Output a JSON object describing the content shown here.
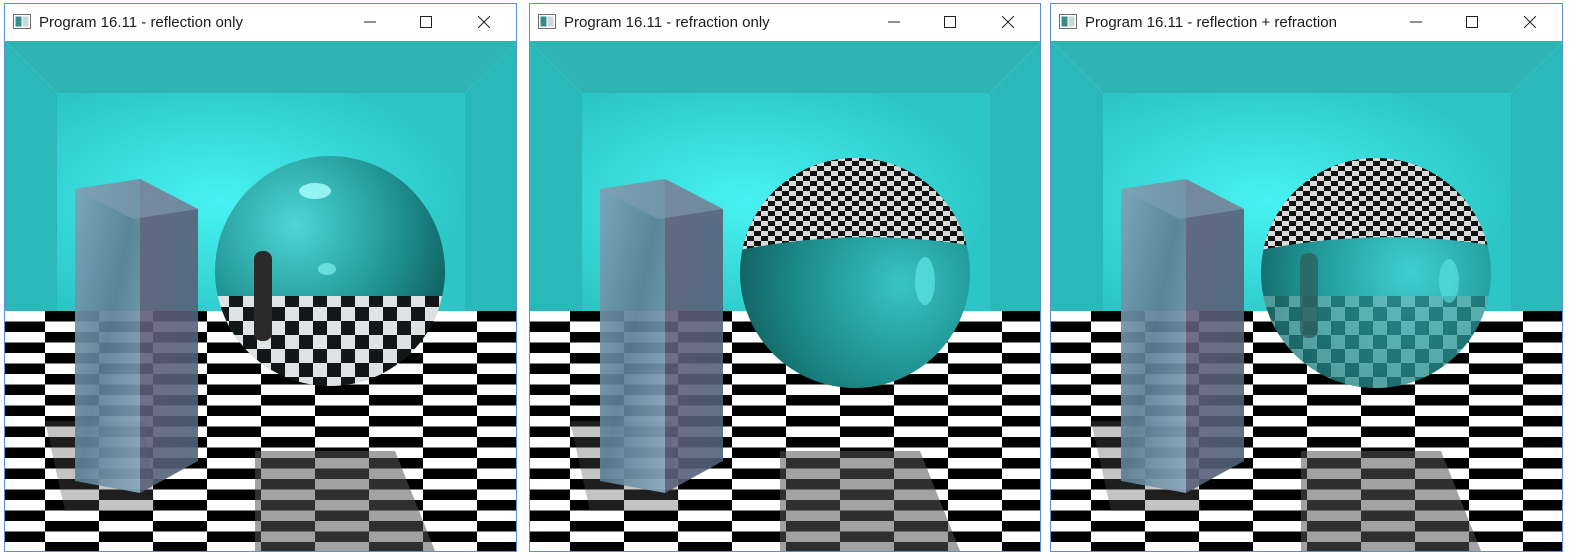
{
  "windows": [
    {
      "title": "Program 16.11 - reflection only",
      "controls": {
        "minimize_icon": "minimize-icon",
        "maximize_icon": "maximize-icon",
        "close_icon": "close-icon"
      },
      "render_mode": "reflection only"
    },
    {
      "title": "Program 16.11 - refraction only",
      "controls": {
        "minimize_icon": "minimize-icon",
        "maximize_icon": "maximize-icon",
        "close_icon": "close-icon"
      },
      "render_mode": "refraction only"
    },
    {
      "title": "Program 16.11 - reflection + refraction",
      "controls": {
        "minimize_icon": "minimize-icon",
        "maximize_icon": "maximize-icon",
        "close_icon": "close-icon"
      },
      "render_mode": "reflection + refraction"
    }
  ],
  "colors": {
    "room_wall": "#3fd8d8",
    "room_side": "#2bbcbc",
    "ceiling": "#2fb8b8",
    "sphere": "#1e8f8f",
    "checker_dark": "#000000",
    "checker_light": "#ffffff",
    "titlebar_border": "#5c8fd6"
  }
}
